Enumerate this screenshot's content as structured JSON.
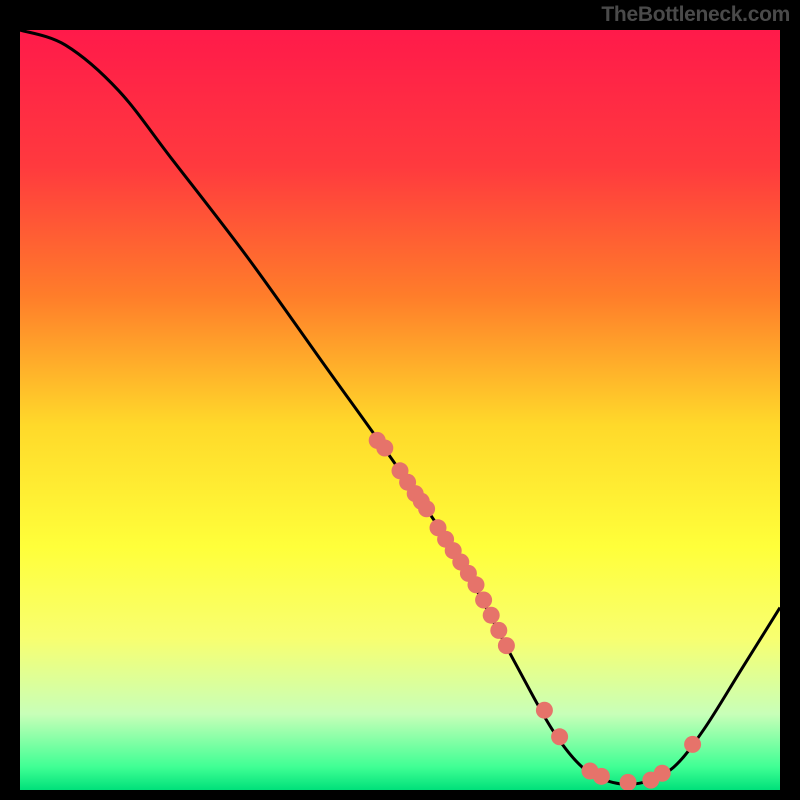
{
  "watermark": "TheBottleneck.com",
  "chart_data": {
    "type": "line",
    "title": "",
    "xlabel": "",
    "ylabel": "",
    "xlim": [
      0,
      100
    ],
    "ylim": [
      0,
      100
    ],
    "gradient_stops": [
      {
        "offset": 0,
        "color": "#ff1a4a"
      },
      {
        "offset": 18,
        "color": "#ff3a3e"
      },
      {
        "offset": 35,
        "color": "#ff7d2a"
      },
      {
        "offset": 52,
        "color": "#ffd92a"
      },
      {
        "offset": 68,
        "color": "#ffff3a"
      },
      {
        "offset": 80,
        "color": "#f8ff70"
      },
      {
        "offset": 90,
        "color": "#c8ffb8"
      },
      {
        "offset": 97,
        "color": "#3fff94"
      },
      {
        "offset": 100,
        "color": "#00e07a"
      }
    ],
    "curve": [
      {
        "x": 0,
        "y": 100
      },
      {
        "x": 6,
        "y": 98
      },
      {
        "x": 13,
        "y": 92
      },
      {
        "x": 20,
        "y": 83
      },
      {
        "x": 30,
        "y": 70
      },
      {
        "x": 40,
        "y": 56
      },
      {
        "x": 50,
        "y": 42
      },
      {
        "x": 58,
        "y": 30
      },
      {
        "x": 65,
        "y": 17
      },
      {
        "x": 70,
        "y": 8
      },
      {
        "x": 74,
        "y": 3
      },
      {
        "x": 78,
        "y": 1
      },
      {
        "x": 82,
        "y": 1
      },
      {
        "x": 86,
        "y": 3
      },
      {
        "x": 90,
        "y": 8
      },
      {
        "x": 95,
        "y": 16
      },
      {
        "x": 100,
        "y": 24
      }
    ],
    "scatter": [
      {
        "x": 47,
        "y": 46
      },
      {
        "x": 48,
        "y": 45
      },
      {
        "x": 50,
        "y": 42
      },
      {
        "x": 51,
        "y": 40.5
      },
      {
        "x": 52,
        "y": 39
      },
      {
        "x": 52.8,
        "y": 38
      },
      {
        "x": 53.5,
        "y": 37
      },
      {
        "x": 55,
        "y": 34.5
      },
      {
        "x": 56,
        "y": 33
      },
      {
        "x": 57,
        "y": 31.5
      },
      {
        "x": 58,
        "y": 30
      },
      {
        "x": 59,
        "y": 28.5
      },
      {
        "x": 60,
        "y": 27
      },
      {
        "x": 61,
        "y": 25
      },
      {
        "x": 62,
        "y": 23
      },
      {
        "x": 63,
        "y": 21
      },
      {
        "x": 64,
        "y": 19
      },
      {
        "x": 69,
        "y": 10.5
      },
      {
        "x": 71,
        "y": 7
      },
      {
        "x": 75,
        "y": 2.5
      },
      {
        "x": 76.5,
        "y": 1.8
      },
      {
        "x": 80,
        "y": 1
      },
      {
        "x": 83,
        "y": 1.3
      },
      {
        "x": 84.5,
        "y": 2.2
      },
      {
        "x": 88.5,
        "y": 6
      }
    ],
    "scatter_color": "#e6736a",
    "curve_color": "#000000"
  }
}
